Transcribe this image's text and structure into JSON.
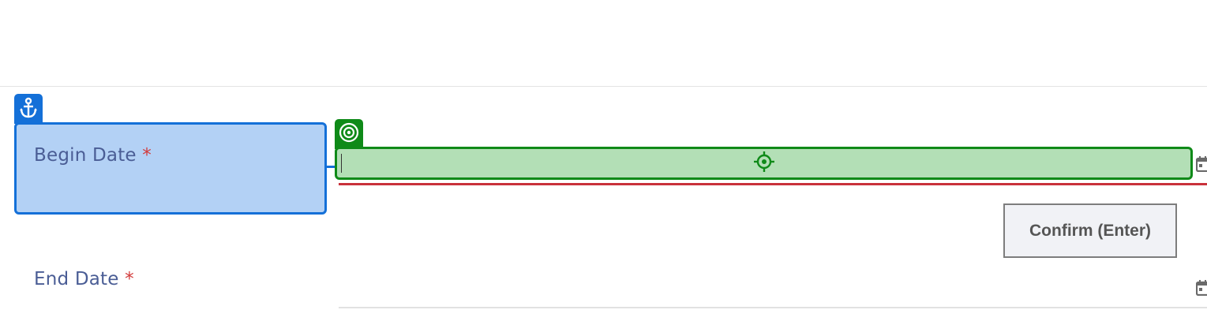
{
  "form": {
    "begin_date": {
      "label": "Begin Date",
      "required_mark": "*",
      "value": ""
    },
    "end_date": {
      "label": "End Date",
      "required_mark": "*",
      "value": ""
    },
    "confirm_button": {
      "label": "Confirm (Enter)"
    }
  },
  "overlays": {
    "anchor_tag": {
      "icon": "anchor-icon",
      "color": "#1470d8"
    },
    "target_tag": {
      "icon": "target-icon",
      "color": "#0f8a18"
    },
    "target_center_icon": "crosshair-icon"
  },
  "icons": {
    "date_picker": "calendar-icon"
  },
  "colors": {
    "anchor_fill": "#b3d1f5",
    "target_fill": "#b3dfb6",
    "error_underline": "#c9313b",
    "label_text": "#4a5d95",
    "required": "#d23a3a"
  }
}
